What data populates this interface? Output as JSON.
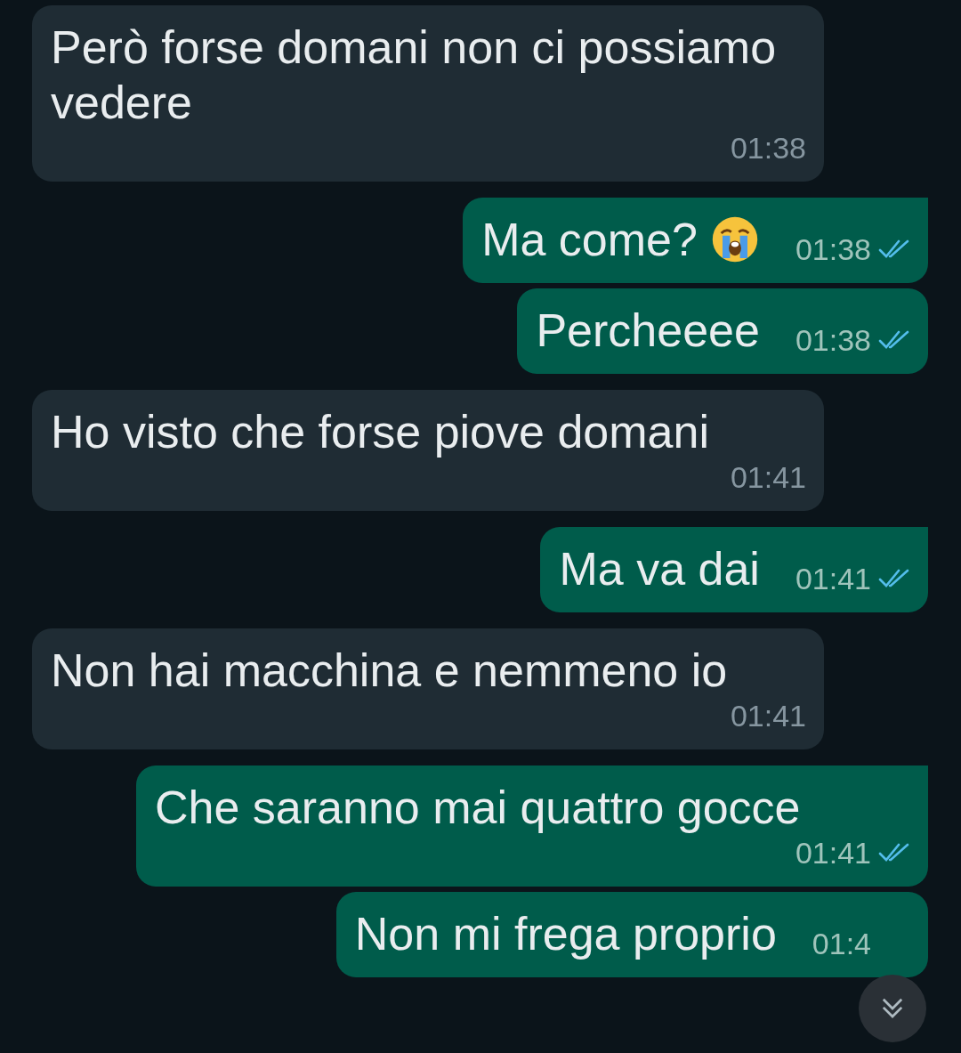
{
  "messages": [
    {
      "kind": "incoming",
      "tail": false,
      "text": "Però forse domani non ci possiamo vedere",
      "time": "01:38"
    },
    {
      "kind": "outgoing",
      "tail": true,
      "text": "Ma come?",
      "emoji": true,
      "time": "01:38",
      "read": true
    },
    {
      "kind": "outgoing",
      "tail": false,
      "text": "Percheeee",
      "time": "01:38",
      "read": true
    },
    {
      "kind": "incoming",
      "tail": false,
      "text": "Ho visto che forse piove domani",
      "time": "01:41"
    },
    {
      "kind": "outgoing",
      "tail": true,
      "text": "Ma va dai",
      "time": "01:41",
      "read": true
    },
    {
      "kind": "incoming",
      "tail": false,
      "text": "Non hai macchina e nemmeno io",
      "time": "01:41"
    },
    {
      "kind": "outgoing",
      "tail": true,
      "text": "Che saranno mai quattro gocce",
      "time": "01:41",
      "read": true
    },
    {
      "kind": "outgoing",
      "tail": false,
      "text": "Non mi frega proprio",
      "time": "01:4"
    }
  ],
  "scroll_down_button": {
    "visible": true
  }
}
